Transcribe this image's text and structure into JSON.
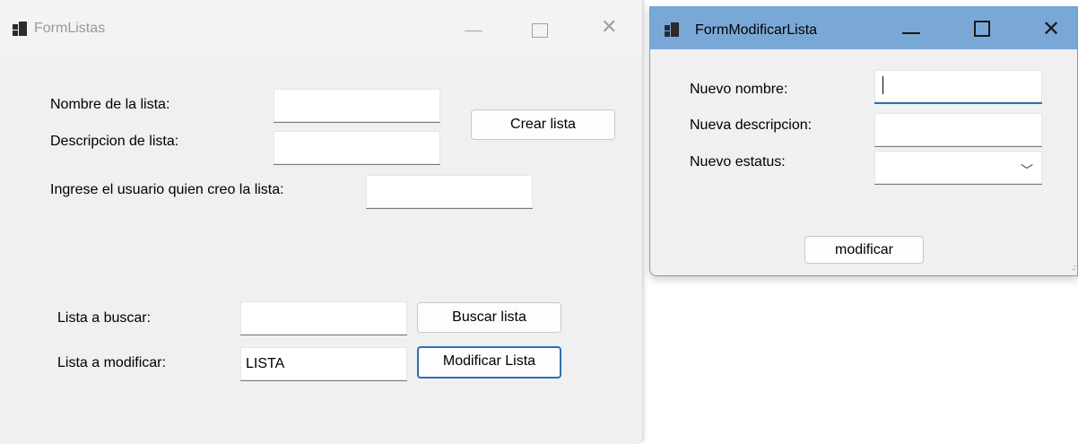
{
  "form_listas": {
    "title": "FormListas",
    "nombre_label": "Nombre de la lista:",
    "nombre_value": "",
    "descripcion_label": "Descripcion de lista:",
    "descripcion_value": "",
    "crear_button": "Crear lista",
    "usuario_label": "Ingrese el usuario quien creo la lista:",
    "usuario_value": "",
    "buscar_label": "Lista a buscar:",
    "buscar_value": "",
    "buscar_button": "Buscar lista",
    "modificar_label": "Lista a modificar:",
    "modificar_value": "LISTA",
    "modificar_button": "Modificar Lista"
  },
  "form_modificar": {
    "title": "FormModificarLista",
    "nombre_label": "Nuevo nombre:",
    "nombre_value": "",
    "descripcion_label": "Nueva descripcion:",
    "descripcion_value": "",
    "estatus_label": "Nuevo estatus:",
    "estatus_selected": "",
    "modificar_button": "modificar"
  },
  "icons": {
    "app": "window-app-icon",
    "minimize": "minimize-icon",
    "maximize": "maximize-icon",
    "close": "close-icon",
    "dropdown": "chevron-down-icon"
  },
  "colors": {
    "active_titlebar": "#7aa8d6",
    "inactive_titlebar": "#f3f3f3",
    "focus_accent": "#2f6fb3"
  }
}
